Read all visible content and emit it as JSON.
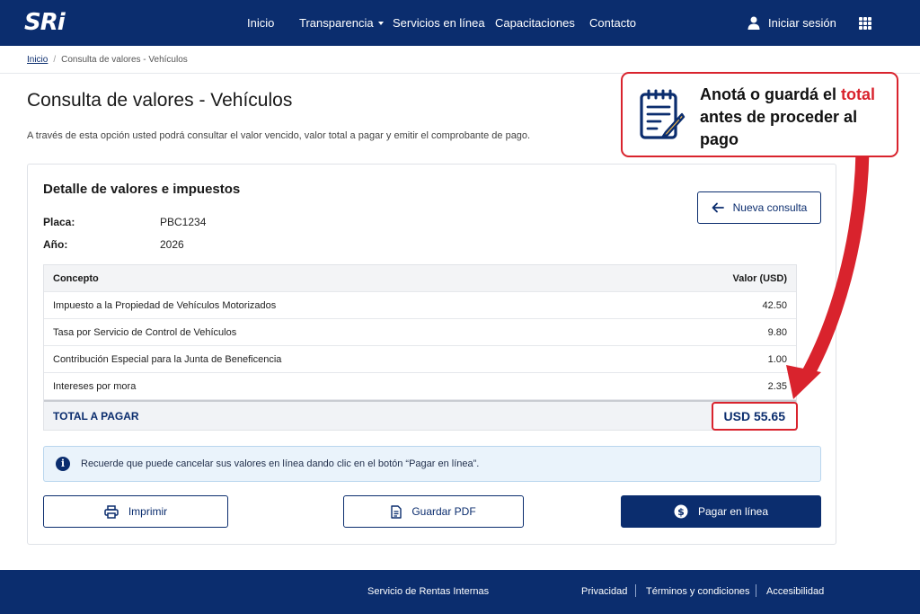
{
  "header": {
    "logo": "SRi",
    "nav": [
      "Inicio",
      "Transparencia",
      "Servicios en línea",
      "Capacitaciones",
      "Contacto"
    ],
    "login_label": "Iniciar sesión"
  },
  "breadcrumb": {
    "home": "Inicio",
    "separator": "/",
    "current": "Consulta de valores - Vehículos"
  },
  "page": {
    "title": "Consulta de valores - Vehículos",
    "subtitle": "A través de esta opción usted podrá consultar el valor vencido, valor total a pagar y emitir el comprobante de pago."
  },
  "card": {
    "title": "Detalle de valores e impuestos",
    "plate_label": "Placa:",
    "plate_value": "PBC1234",
    "year_label": "Año:",
    "year_value": "2026",
    "new_query_label": "Nueva consulta"
  },
  "table": {
    "headers": [
      "Concepto",
      "Valor (USD)"
    ],
    "rows": [
      {
        "concept": "Impuesto a la Propiedad de Vehículos Motorizados",
        "value": "42.50"
      },
      {
        "concept": "Tasa por Servicio de Control de Vehículos",
        "value": "9.80"
      },
      {
        "concept": "Contribución Especial para la Junta de Beneficencia",
        "value": "1.00"
      },
      {
        "concept": "Intereses por mora",
        "value": "2.35"
      }
    ],
    "total_label": "TOTAL A PAGAR",
    "total_value": "USD 55.65"
  },
  "info_message": "Recuerde que puede cancelar sus valores en línea dando clic en el botón “Pagar en línea”.",
  "actions": {
    "print": "Imprimir",
    "save_pdf": "Guardar PDF",
    "pay": "Pagar en línea"
  },
  "footer": {
    "org": "Servicio de Rentas Internas",
    "links": [
      "Privacidad",
      "Términos y condiciones",
      "Accesibilidad"
    ]
  },
  "callout": {
    "text_before": "Anotá o guardá el",
    "highlight": "total",
    "text_after": "antes de proceder al pago"
  },
  "colors": {
    "brand_blue": "#0b2d6e",
    "highlight_red": "#d9232d",
    "info_bg": "#eaf3fb"
  },
  "icons": [
    "user-icon",
    "apps-grid-icon",
    "arrow-left-icon",
    "info-icon",
    "printer-icon",
    "document-icon",
    "dollar-circle-icon",
    "notepad-pencil-icon"
  ]
}
